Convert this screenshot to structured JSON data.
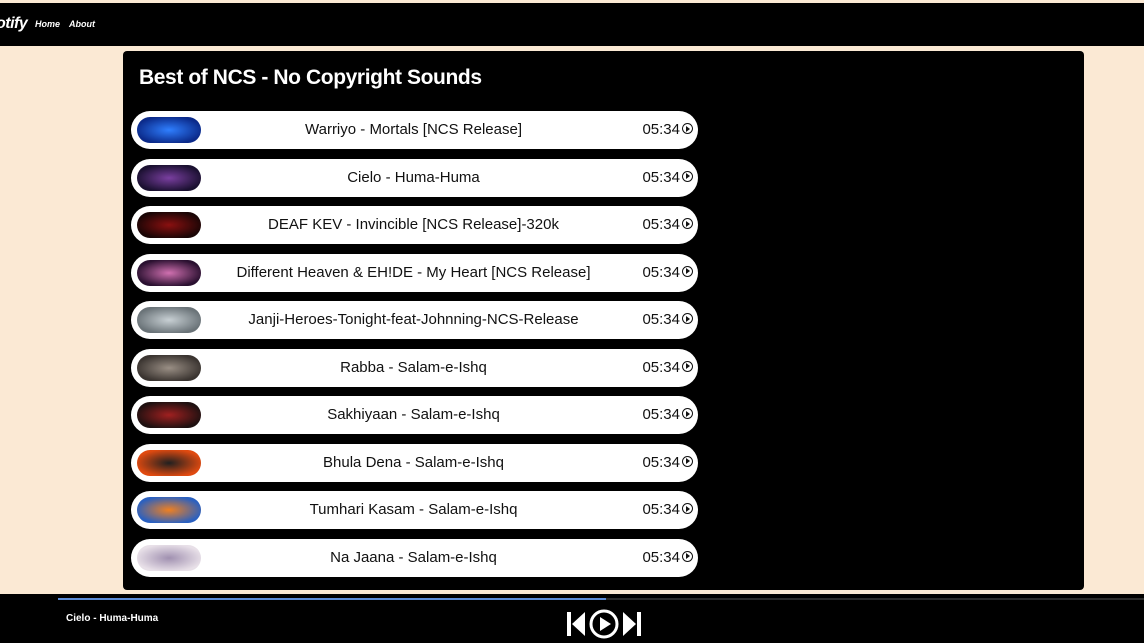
{
  "header": {
    "logo": "otify",
    "nav": [
      {
        "label": "Home"
      },
      {
        "label": "About"
      }
    ]
  },
  "playlist": {
    "title": "Best of NCS - No Copyright Sounds",
    "tracks": [
      {
        "name": "Warriyo - Mortals [NCS Release]",
        "duration": "05:34",
        "thumb": [
          "#0b2a8a",
          "#2f7fff"
        ]
      },
      {
        "name": "Cielo - Huma-Huma",
        "duration": "05:34",
        "thumb": [
          "#1a1030",
          "#7a3fa0"
        ]
      },
      {
        "name": "DEAF KEV - Invincible [NCS Release]-320k",
        "duration": "05:34",
        "thumb": [
          "#1a0505",
          "#8a1010"
        ]
      },
      {
        "name": "Different Heaven & EH!DE - My Heart [NCS Release]",
        "duration": "05:34",
        "thumb": [
          "#2a1030",
          "#d070b0"
        ]
      },
      {
        "name": "Janji-Heroes-Tonight-feat-Johnning-NCS-Release",
        "duration": "05:34",
        "thumb": [
          "#6a7378",
          "#c8d0d4"
        ]
      },
      {
        "name": "Rabba - Salam-e-Ishq",
        "duration": "05:34",
        "thumb": [
          "#3a3430",
          "#9a8f85"
        ]
      },
      {
        "name": "Sakhiyaan - Salam-e-Ishq",
        "duration": "05:34",
        "thumb": [
          "#1e1010",
          "#a02020"
        ]
      },
      {
        "name": "Bhula Dena - Salam-e-Ishq",
        "duration": "05:34",
        "thumb": [
          "#e04a10",
          "#202020"
        ]
      },
      {
        "name": "Tumhari Kasam - Salam-e-Ishq",
        "duration": "05:34",
        "thumb": [
          "#2a60c0",
          "#f08020"
        ]
      },
      {
        "name": "Na Jaana - Salam-e-Ishq",
        "duration": "05:34",
        "thumb": [
          "#e8e0e8",
          "#a090b0"
        ]
      }
    ]
  },
  "player": {
    "now_playing": "Cielo - Huma-Huma",
    "progress": 0.505,
    "progress_color": "#5b8bd6",
    "controls": [
      "previous-icon",
      "play-icon",
      "next-icon"
    ]
  }
}
